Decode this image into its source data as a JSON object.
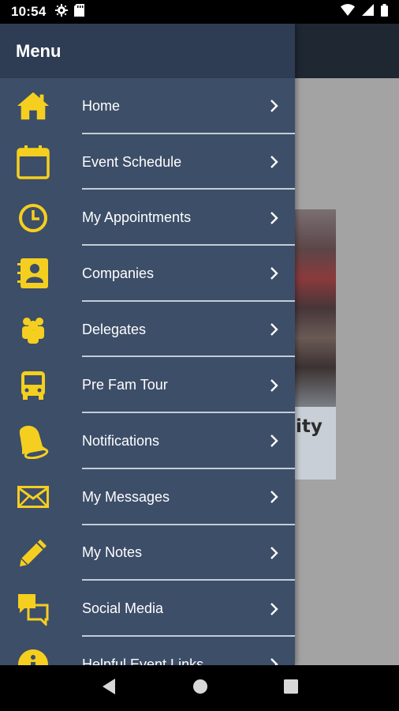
{
  "status_bar": {
    "time": "10:54"
  },
  "drawer": {
    "title": "Menu",
    "items": [
      {
        "label": "Home",
        "icon": "home-icon"
      },
      {
        "label": "Event Schedule",
        "icon": "calendar-icon"
      },
      {
        "label": "My Appointments",
        "icon": "clock-icon"
      },
      {
        "label": "Companies",
        "icon": "contact-book-icon"
      },
      {
        "label": "Delegates",
        "icon": "people-icon"
      },
      {
        "label": "Pre Fam Tour",
        "icon": "bus-icon"
      },
      {
        "label": "Notifications",
        "icon": "bell-icon"
      },
      {
        "label": "My Messages",
        "icon": "envelope-icon"
      },
      {
        "label": "My Notes",
        "icon": "pencil-icon"
      },
      {
        "label": "Social Media",
        "icon": "chat-bubbles-icon"
      },
      {
        "label": "Helpful Event Links",
        "icon": "info-icon"
      }
    ]
  },
  "background": {
    "photo_text": "ity"
  },
  "colors": {
    "accent": "#f5cf1f",
    "drawer_bg": "#3d4e68",
    "drawer_header": "#2f3d54"
  }
}
